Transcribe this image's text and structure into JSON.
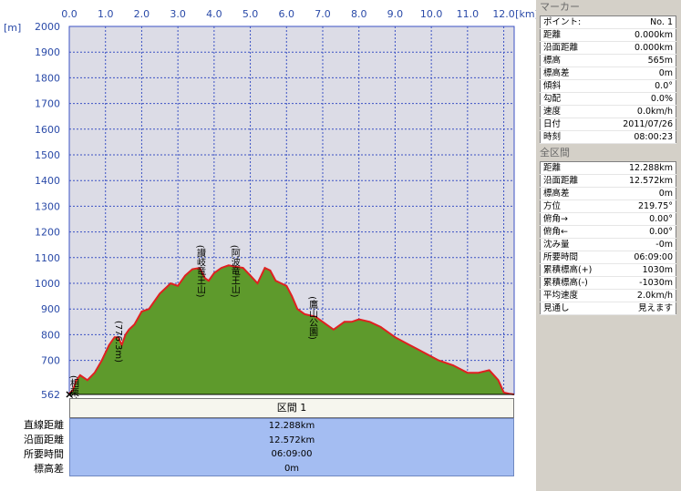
{
  "chart_data": {
    "type": "area",
    "x_unit": "[km]",
    "y_unit": "[m]",
    "x_ticks": [
      "0.0",
      "1.0",
      "2.0",
      "3.0",
      "4.0",
      "5.0",
      "6.0",
      "7.0",
      "8.0",
      "9.0",
      "10.0",
      "11.0",
      "12.0"
    ],
    "y_ticks": [
      "2000",
      "1900",
      "1800",
      "1700",
      "1600",
      "1500",
      "1400",
      "1300",
      "1200",
      "1100",
      "1000",
      "900",
      "800",
      "700",
      "562"
    ],
    "xlim": [
      0,
      12.288
    ],
    "ylim": [
      562,
      2000
    ],
    "grid": true,
    "x": [
      0,
      0.1,
      0.2,
      0.3,
      0.5,
      0.7,
      0.9,
      1.1,
      1.25,
      1.35,
      1.45,
      1.55,
      1.65,
      1.8,
      2.0,
      2.2,
      2.5,
      2.8,
      3.0,
      3.2,
      3.4,
      3.6,
      3.75,
      3.85,
      4.0,
      4.2,
      4.4,
      4.6,
      4.8,
      5.0,
      5.2,
      5.4,
      5.55,
      5.7,
      5.85,
      6.0,
      6.15,
      6.3,
      6.5,
      6.8,
      7.0,
      7.3,
      7.6,
      7.8,
      8.0,
      8.3,
      8.6,
      9.0,
      9.4,
      9.8,
      10.2,
      10.6,
      11.0,
      11.3,
      11.6,
      11.85,
      12.0,
      12.15,
      12.288
    ],
    "y": [
      565,
      580,
      620,
      640,
      620,
      650,
      700,
      760,
      790,
      790,
      760,
      800,
      820,
      840,
      890,
      900,
      960,
      1000,
      990,
      1030,
      1055,
      1060,
      1020,
      1010,
      1040,
      1060,
      1070,
      1065,
      1060,
      1030,
      1000,
      1060,
      1050,
      1010,
      1000,
      990,
      950,
      900,
      880,
      870,
      850,
      820,
      850,
      850,
      860,
      850,
      830,
      790,
      760,
      730,
      700,
      680,
      650,
      650,
      660,
      620,
      570,
      565,
      562
    ],
    "annotations": [
      {
        "label": "(相栗峠)",
        "x": 0.1,
        "y": 640
      },
      {
        "label": "(776.3m)",
        "x": 1.35,
        "y": 855
      },
      {
        "label": "(讃岐竜王山)",
        "x": 3.6,
        "y": 1150
      },
      {
        "label": "(阿波竜王山)",
        "x": 4.55,
        "y": 1150
      },
      {
        "label": "(鷹山公園)",
        "x": 6.7,
        "y": 950
      }
    ]
  },
  "segment": {
    "header": "区間 1",
    "labels": [
      "直線距離",
      "沿面距離",
      "所要時間",
      "標高差"
    ],
    "values": [
      "12.288km",
      "12.572km",
      "06:09:00",
      "0m"
    ]
  },
  "marker": {
    "title": "マーカー",
    "rows": [
      [
        "ポイント:",
        "No. 1"
      ],
      [
        "距離",
        "0.000km"
      ],
      [
        "沿面距離",
        "0.000km"
      ],
      [
        "標高",
        "565m"
      ],
      [
        "標高差",
        "0m"
      ],
      [
        "傾斜",
        "0.0°"
      ],
      [
        "勾配",
        "0.0%"
      ],
      [
        "速度",
        "0.0km/h"
      ],
      [
        "日付",
        "2011/07/26"
      ],
      [
        "時刻",
        "08:00:23"
      ]
    ]
  },
  "total": {
    "title": "全区間",
    "rows": [
      [
        "距離",
        "12.288km"
      ],
      [
        "沿面距離",
        "12.572km"
      ],
      [
        "標高差",
        "0m"
      ],
      [
        "方位",
        "219.75°"
      ],
      [
        "俯角→",
        "0.00°"
      ],
      [
        "俯角←",
        "0.00°"
      ],
      [
        "沈み量",
        "-0m"
      ],
      [
        "所要時間",
        "06:09:00"
      ],
      [
        "累積標高(+)",
        "1030m"
      ],
      [
        "累積標高(-)",
        "-1030m"
      ],
      [
        "平均速度",
        "2.0km/h"
      ],
      [
        "見通し",
        "見えます"
      ]
    ]
  },
  "colors": {
    "plot_bg": "#dcdce6",
    "grid": "#3b52c4",
    "fill": "#5e9a2c",
    "line": "#e02020",
    "segment_bg": "#a4bdf2"
  }
}
